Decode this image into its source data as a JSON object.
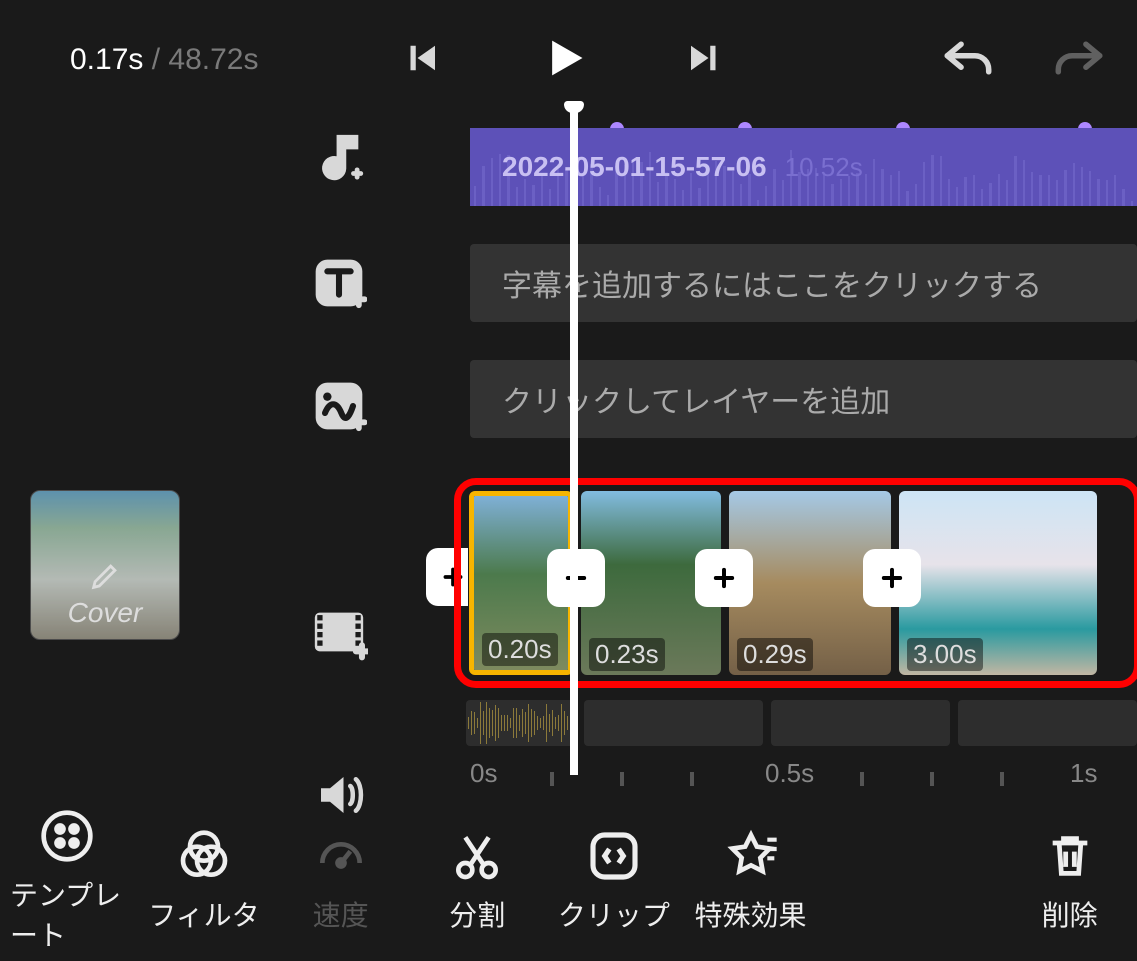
{
  "playback": {
    "current_time": "0.17s",
    "separator": " / ",
    "total_time": "48.72s"
  },
  "cover": {
    "label": "Cover"
  },
  "tracks": {
    "audio": {
      "title": "2022-05-01-15-57-06",
      "duration": "10.52s"
    },
    "subtitle_prompt": "字幕を追加するにはここをクリックする",
    "layer_prompt": "クリックしてレイヤーを追加",
    "clips": [
      {
        "duration": "0.20s"
      },
      {
        "duration": "0.23s"
      },
      {
        "duration": "0.29s"
      },
      {
        "duration": "3.00s"
      }
    ]
  },
  "ruler": {
    "t0": "0s",
    "t1": "0.5s",
    "t2": "1s"
  },
  "bottom": {
    "template": "テンプレート",
    "filter": "フィルタ",
    "speed": "速度",
    "split": "分割",
    "clip": "クリップ",
    "fx": "特殊効果",
    "delete": "削除"
  }
}
